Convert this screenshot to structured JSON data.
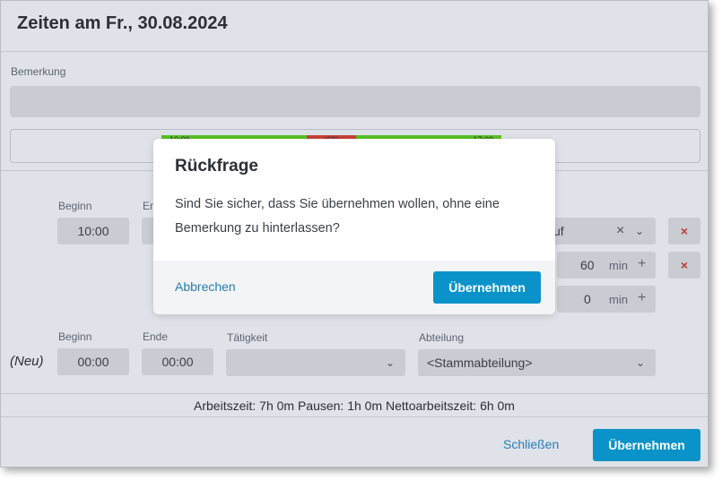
{
  "window": {
    "title": "Zeiten am Fr., 30.08.2024",
    "remark_label": "Bemerkung",
    "timeline": {
      "start": "10:00",
      "pause": "(60)",
      "end": "17:00"
    },
    "entry1": {
      "begin_label": "Beginn",
      "end_label_partial": "En",
      "begin": "10:00",
      "activity_partial": "uf",
      "clear_icon": "×",
      "delete_icon": "×"
    },
    "entry2": {
      "value": "60",
      "unit": "min",
      "plus": "+",
      "delete_icon": "×"
    },
    "entry3": {
      "value": "0",
      "unit": "min",
      "plus": "+"
    },
    "new_entry": {
      "row_label": "(Neu)",
      "begin_label": "Beginn",
      "end_label": "Ende",
      "activity_label": "Tätigkeit",
      "department_label": "Abteilung",
      "begin": "00:00",
      "end": "00:00",
      "activity": "",
      "department": "<Stammabteilung>"
    },
    "summary": "Arbeitszeit: 7h 0m Pausen: 1h 0m Nettoarbeitszeit: 6h 0m",
    "footer": {
      "close_label": "Schließen",
      "apply_label": "Übernehmen"
    }
  },
  "dialog": {
    "title": "Rückfrage",
    "message": "Sind Sie sicher, dass Sie übernehmen wollen, ohne eine Bemerkung zu hinterlassen?",
    "cancel_label": "Abbrechen",
    "confirm_label": "Übernehmen"
  },
  "colors": {
    "primary": "#0a93c9",
    "link": "#2a7db4",
    "delete": "#c03a33",
    "timeline_work": "#58c124",
    "timeline_pause": "#c84139"
  },
  "icons": {
    "chevron": "chevron-down-icon",
    "clear": "close-icon",
    "delete": "delete-icon",
    "plus": "plus-icon"
  }
}
